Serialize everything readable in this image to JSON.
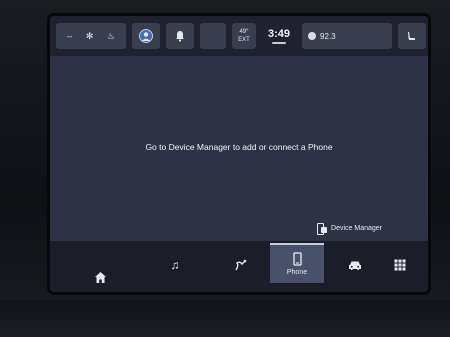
{
  "status_bar": {
    "climate_dash": "--",
    "temp_value": "49°",
    "temp_label": "EXT",
    "time": "3:49",
    "radio_station": "92.3"
  },
  "main": {
    "message": "Go to Device Manager to add or connect a Phone",
    "device_manager_label": "Device Manager"
  },
  "nav": {
    "phone_label": "Phone",
    "items": [
      "home",
      "music",
      "navigation",
      "phone",
      "vehicle",
      "apps"
    ]
  },
  "icons": {
    "home": "home-icon",
    "music": "music-note-icon",
    "navigation": "navigation-icon",
    "phone": "phone-icon",
    "vehicle": "car-icon",
    "apps": "apps-grid-icon",
    "bell": "bell-icon",
    "avatar": "user-avatar-icon",
    "seat": "seat-icon"
  }
}
